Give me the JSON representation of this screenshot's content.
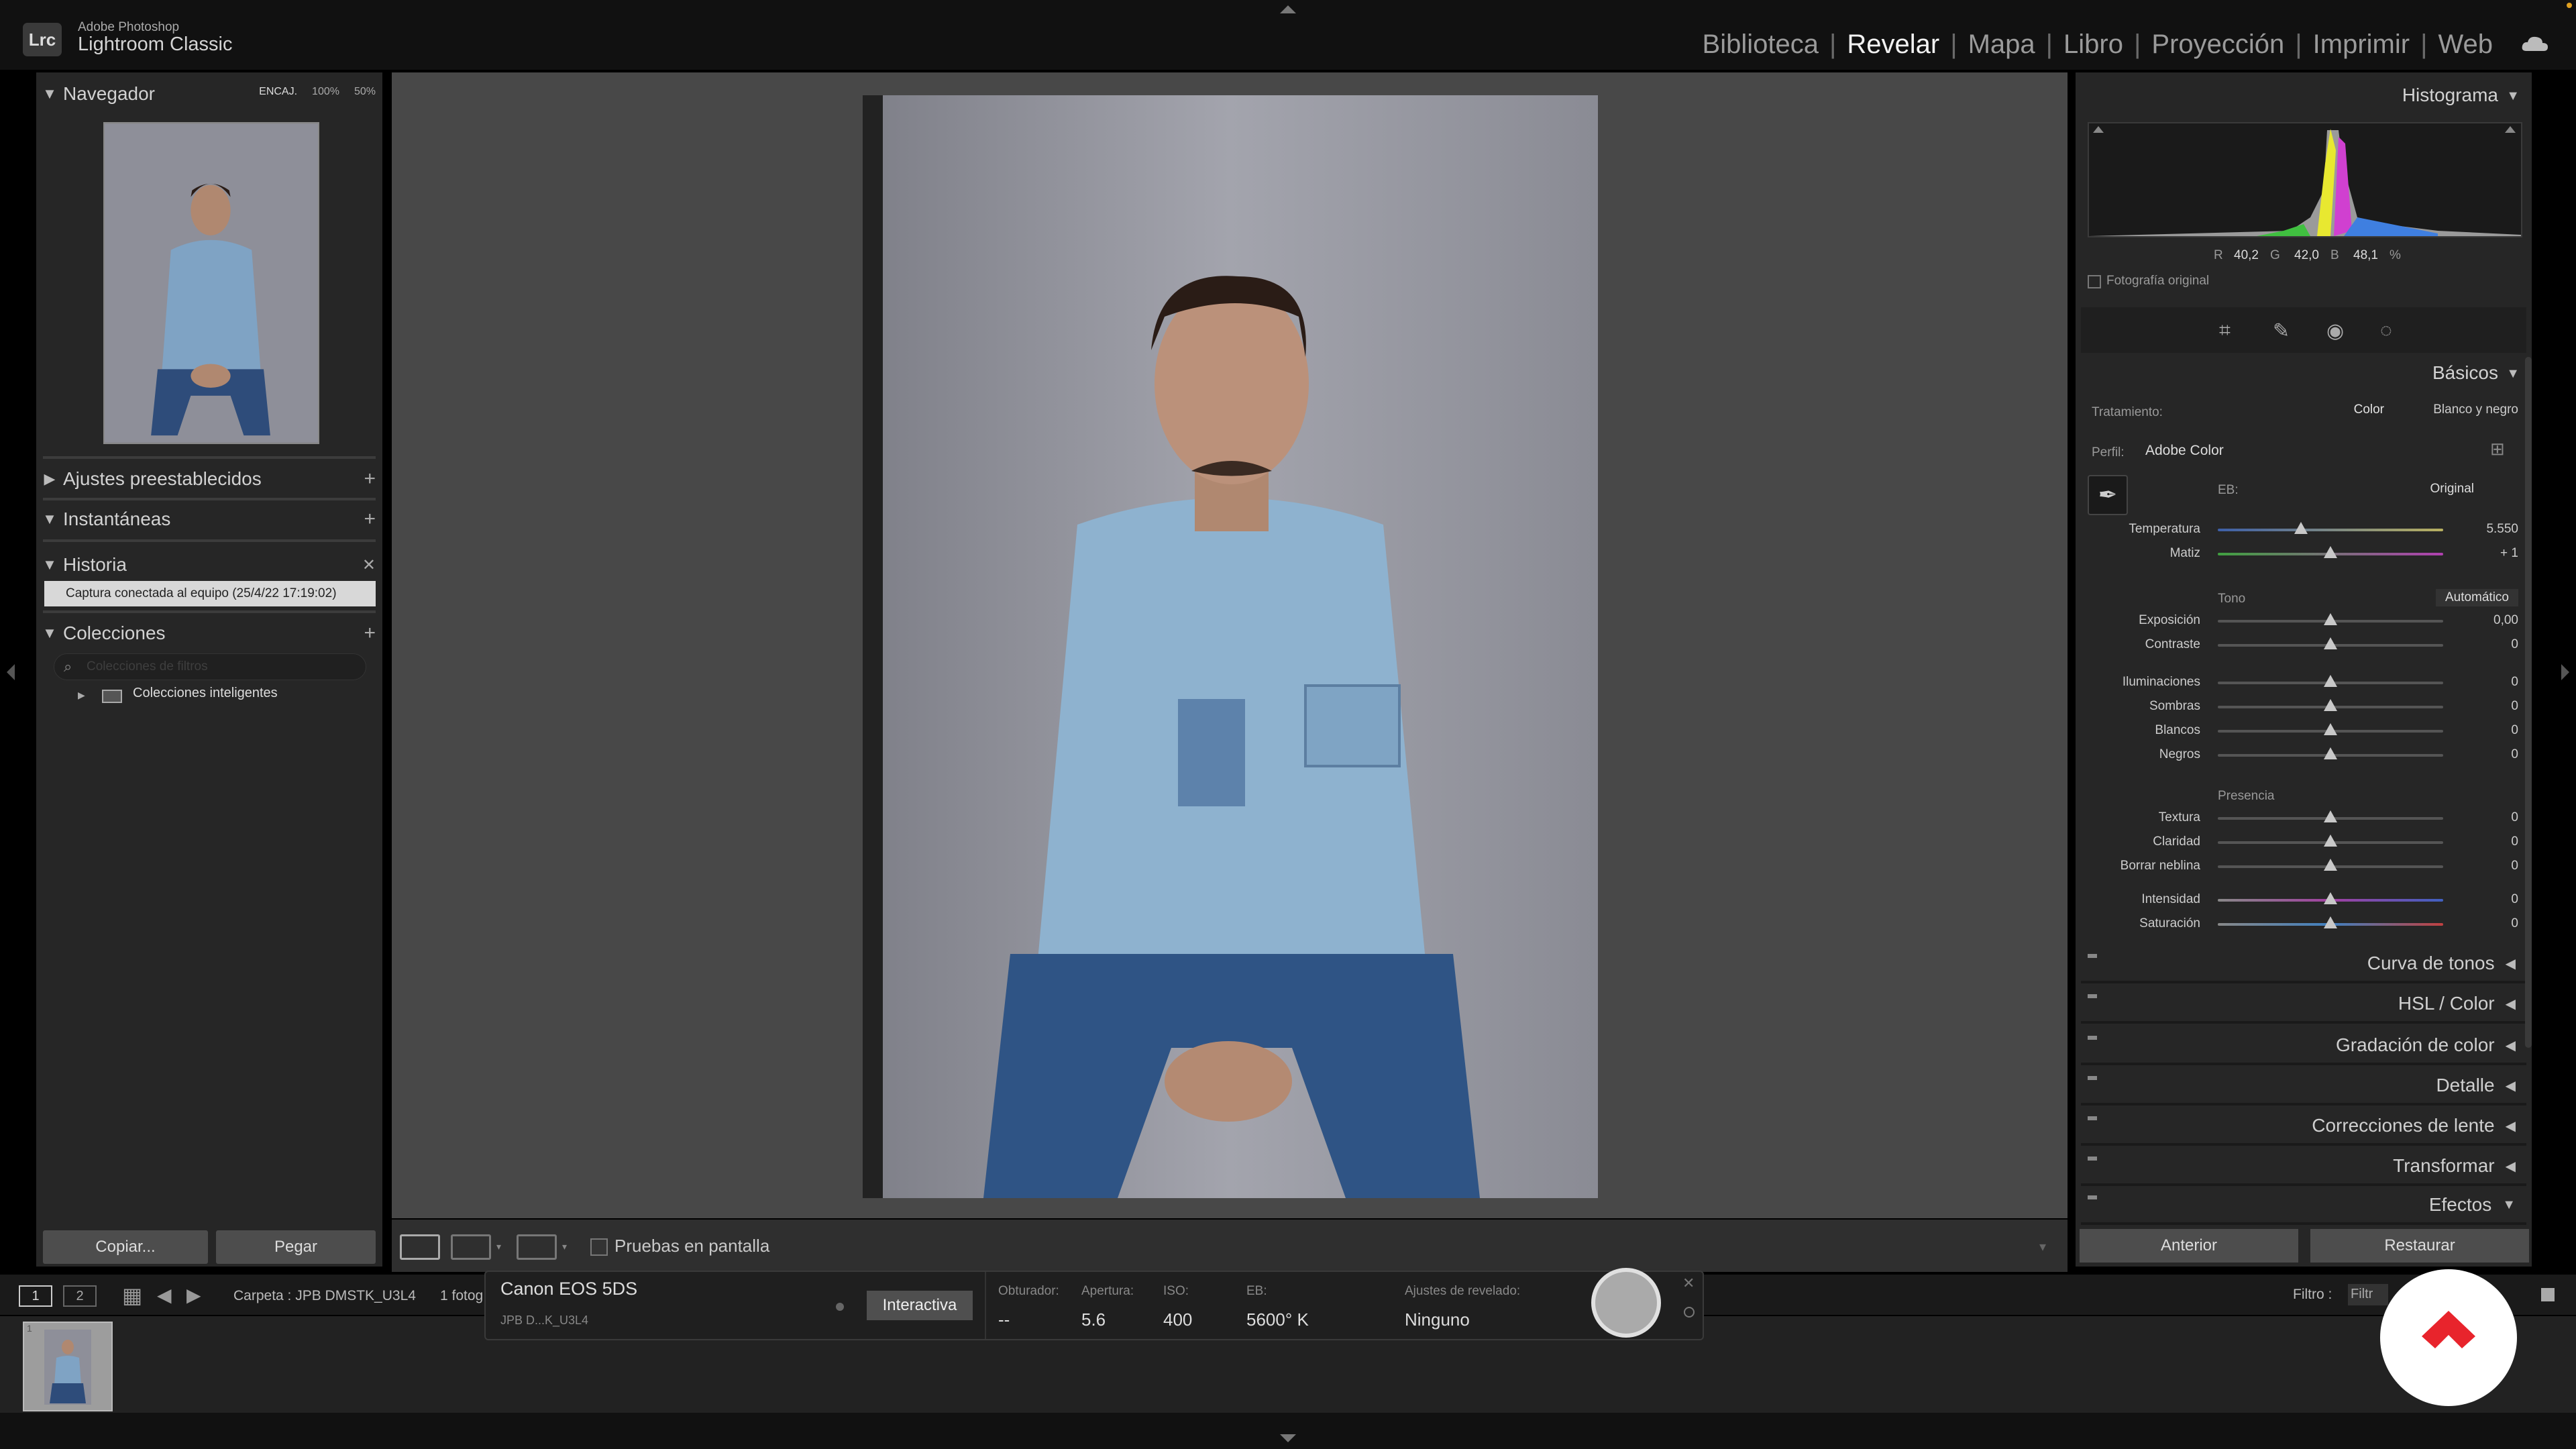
{
  "app": {
    "brand_line1": "Adobe Photoshop",
    "brand_line2": "Lightroom Classic",
    "logo": "Lrc"
  },
  "modules": [
    "Biblioteca",
    "Revelar",
    "Mapa",
    "Libro",
    "Proyección",
    "Imprimir",
    "Web"
  ],
  "active_module": "Revelar",
  "left_panel": {
    "navigator": {
      "title": "Navegador",
      "zoom": [
        "ENCAJ.",
        "100%",
        "50%"
      ]
    },
    "presets": {
      "title": "Ajustes preestablecidos"
    },
    "snapshots": {
      "title": "Instantáneas"
    },
    "history": {
      "title": "Historia",
      "items": [
        "Captura conectada al equipo (25/4/22 17:19:02)"
      ]
    },
    "collections": {
      "title": "Colecciones",
      "search_placeholder": "Colecciones de filtros",
      "smart": "Colecciones inteligentes"
    },
    "copy_label": "Copiar...",
    "paste_label": "Pegar"
  },
  "toolbar": {
    "softproof_label": "Pruebas en pantalla"
  },
  "right_panel": {
    "histogram": {
      "title": "Histograma",
      "r_label": "R",
      "r": "40,2",
      "g_label": "G",
      "g": "42,0",
      "b_label": "B",
      "b": "48,1",
      "pct": "%",
      "original_photo": "Fotografía original"
    },
    "basics": {
      "title": "Básicos",
      "treatment_label": "Tratamiento:",
      "treatment_color": "Color",
      "treatment_bw": "Blanco y negro",
      "profile_label": "Perfil:",
      "profile_value": "Adobe Color",
      "wb_label": "EB:",
      "wb_value": "Original",
      "tone_label": "Tono",
      "auto_label": "Automático",
      "presence_label": "Presencia",
      "sliders": [
        {
          "label": "Temperatura",
          "value": "5.550",
          "pos": 0.37
        },
        {
          "label": "Matiz",
          "value": "+ 1",
          "pos": 0.5
        },
        {
          "label": "Exposición",
          "value": "0,00",
          "pos": 0.5
        },
        {
          "label": "Contraste",
          "value": "0",
          "pos": 0.5
        },
        {
          "label": "Iluminaciones",
          "value": "0",
          "pos": 0.5
        },
        {
          "label": "Sombras",
          "value": "0",
          "pos": 0.5
        },
        {
          "label": "Blancos",
          "value": "0",
          "pos": 0.5
        },
        {
          "label": "Negros",
          "value": "0",
          "pos": 0.5
        },
        {
          "label": "Textura",
          "value": "0",
          "pos": 0.5
        },
        {
          "label": "Claridad",
          "value": "0",
          "pos": 0.5
        },
        {
          "label": "Borrar neblina",
          "value": "0",
          "pos": 0.5
        },
        {
          "label": "Intensidad",
          "value": "0",
          "pos": 0.5
        },
        {
          "label": "Saturación",
          "value": "0",
          "pos": 0.5
        }
      ]
    },
    "sections": [
      "Curva de tonos",
      "HSL / Color",
      "Gradación de color",
      "Detalle",
      "Correcciones de lente",
      "Transformar",
      "Efectos"
    ],
    "previous_label": "Anterior",
    "reset_label": "Restaurar"
  },
  "filmstrip": {
    "page1": "1",
    "page2": "2",
    "source": "Carpeta : JPB DMSTK_U3L4",
    "count": "1 fotog",
    "filter_label": "Filtro :",
    "filter_value": "Filtr",
    "thumb_index": "1"
  },
  "tether": {
    "camera": "Canon EOS 5DS",
    "session": "JPB D...K_U3L4",
    "interactive": "Interactiva",
    "shutter_label": "Obturador:",
    "shutter_value": "--",
    "aperture_label": "Apertura:",
    "aperture_value": "5.6",
    "iso_label": "ISO:",
    "iso_value": "400",
    "wb_label": "EB:",
    "wb_value": "5600° K",
    "develop_label": "Ajustes de revelado:",
    "develop_value": "Ninguno"
  },
  "colors": {
    "accent_red": "#e8242c",
    "panel": "#262626",
    "center": "#484848"
  }
}
